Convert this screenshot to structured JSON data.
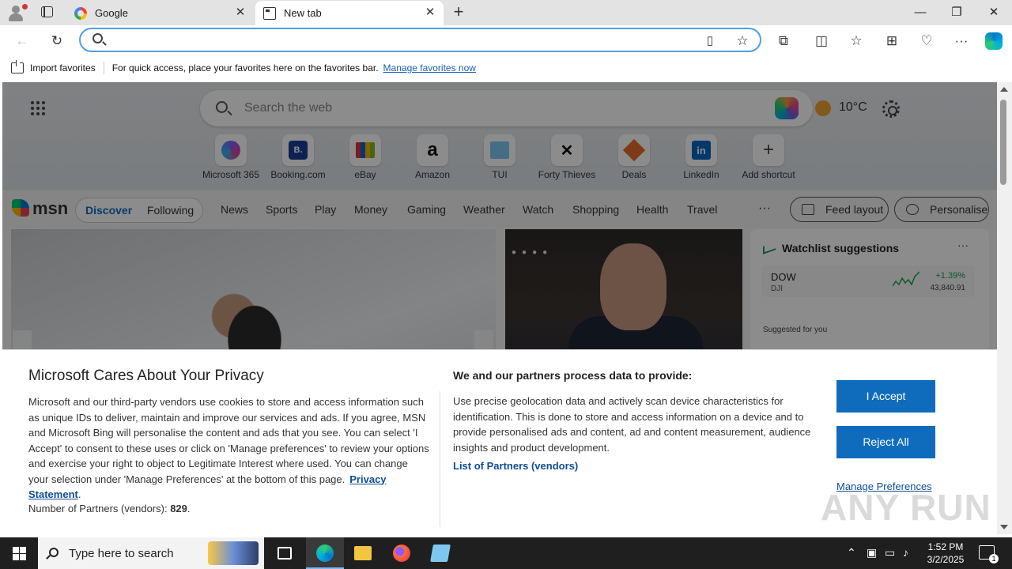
{
  "tabs": [
    {
      "title": "Google"
    },
    {
      "title": "New tab"
    }
  ],
  "address_bar": {
    "value": "",
    "placeholder": ""
  },
  "favorites_bar": {
    "import_label": "Import favorites",
    "message": "For quick access, place your favorites here on the favorites bar.",
    "manage_link": "Manage favorites now"
  },
  "newtab": {
    "search_placeholder": "Search the web",
    "weather_temp": "10°C",
    "shortcuts": [
      {
        "label": "Microsoft 365",
        "icon": "m365-icon"
      },
      {
        "label": "Booking.com",
        "icon": "booking-icon",
        "glyph": "B."
      },
      {
        "label": "eBay",
        "icon": "ebay-icon"
      },
      {
        "label": "Amazon",
        "icon": "amazon-icon",
        "glyph": "a"
      },
      {
        "label": "TUI",
        "icon": "tui-icon"
      },
      {
        "label": "Forty Thieves",
        "icon": "forty-thieves-icon",
        "glyph": "✕"
      },
      {
        "label": "Deals",
        "icon": "deals-icon"
      },
      {
        "label": "LinkedIn",
        "icon": "linkedin-icon",
        "glyph": "in"
      },
      {
        "label": "Add shortcut",
        "icon": "plus-icon",
        "glyph": "+"
      }
    ]
  },
  "msn_nav": {
    "logo": "msn",
    "discover": "Discover",
    "following": "Following",
    "items": [
      "News",
      "Sports",
      "Play",
      "Money",
      "Gaming",
      "Weather",
      "Watch",
      "Shopping",
      "Health",
      "Travel"
    ],
    "more": "···",
    "feed_layout": "Feed layout",
    "personalise": "Personalise"
  },
  "watchlist": {
    "title": "Watchlist suggestions",
    "more": "···",
    "row": {
      "symbol": "DOW",
      "exchange": "DJI",
      "change": "+1.39%",
      "value": "43,840.91"
    },
    "suggested": "Suggested for you"
  },
  "privacy": {
    "title": "Microsoft Cares About Your Privacy",
    "body": "Microsoft and our third-party vendors use cookies to store and access information such as unique IDs to deliver, maintain and improve our services and ads. If you agree, MSN and Microsoft Bing will personalise the content and ads that you see. You can select 'I Accept' to consent to these uses or click on 'Manage preferences' to review your options and exercise your right to object to Legitimate Interest where used.  You can change your selection under 'Manage Preferences' at the bottom of this page.",
    "privacy_link": "Privacy Statement",
    "vendors_label": "Number of Partners (vendors):",
    "vendors_count": "829",
    "process_title": "We and our partners process data to provide:",
    "process_desc": "Use precise geolocation data and actively scan device characteristics for identification. This is done to store and access information on a device and to provide personalised ads and content, ad and content measurement, audience insights and product development.",
    "partners_link": "List of Partners (vendors)",
    "accept": "I Accept",
    "reject": "Reject All",
    "manage": "Manage Preferences"
  },
  "watermark": "ANY RUN",
  "taskbar": {
    "search_placeholder": "Type here to search",
    "time": "1:52 PM",
    "date": "3/2/2025",
    "notification_count": "1"
  },
  "colors": {
    "accent": "#0f6cbd",
    "address_focus": "#4f9fe6",
    "taskbar": "#1f1f1f"
  }
}
